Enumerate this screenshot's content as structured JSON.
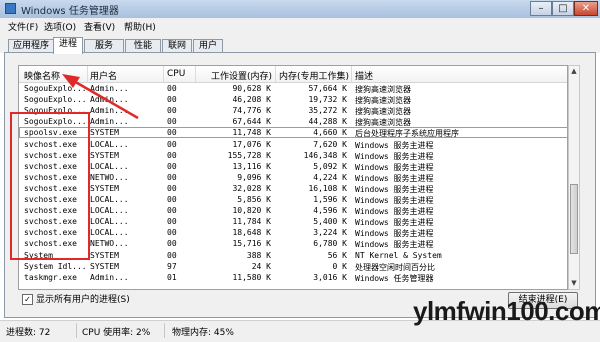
{
  "window": {
    "title": "Windows 任务管理器",
    "min": "–",
    "max": "□",
    "close": "✕"
  },
  "menu": [
    "文件(F)",
    "选项(O)",
    "查看(V)",
    "帮助(H)"
  ],
  "tabs": [
    "应用程序",
    "进程",
    "服务",
    "性能",
    "联网",
    "用户"
  ],
  "active_tab": "进程",
  "columns": [
    "映像名称",
    "用户名",
    "CPU",
    "工作设置(内存)",
    "内存(专用工作集)",
    "描述"
  ],
  "rows": [
    [
      "SogouExplo...",
      "Admin...",
      "00",
      "90,628 K",
      "57,664 K",
      "搜狗高速浏览器"
    ],
    [
      "SogouExplo...",
      "Admin...",
      "00",
      "46,208 K",
      "19,732 K",
      "搜狗高速浏览器"
    ],
    [
      "SogouExplo...",
      "Admin...",
      "00",
      "74,776 K",
      "35,272 K",
      "搜狗高速浏览器"
    ],
    [
      "SogouExplo...",
      "Admin...",
      "00",
      "67,644 K",
      "44,288 K",
      "搜狗高速浏览器"
    ],
    [
      "spoolsv.exe",
      "SYSTEM",
      "00",
      "11,748 K",
      "4,660 K",
      "后台处理程序子系统应用程序"
    ],
    [
      "svchost.exe",
      "LOCAL...",
      "00",
      "17,076 K",
      "7,620 K",
      "Windows 服务主进程"
    ],
    [
      "svchost.exe",
      "SYSTEM",
      "00",
      "155,728 K",
      "146,348 K",
      "Windows 服务主进程"
    ],
    [
      "svchost.exe",
      "LOCAL...",
      "00",
      "13,116 K",
      "5,092 K",
      "Windows 服务主进程"
    ],
    [
      "svchost.exe",
      "NETWO...",
      "00",
      "9,096 K",
      "4,224 K",
      "Windows 服务主进程"
    ],
    [
      "svchost.exe",
      "SYSTEM",
      "00",
      "32,028 K",
      "16,108 K",
      "Windows 服务主进程"
    ],
    [
      "svchost.exe",
      "LOCAL...",
      "00",
      "5,856 K",
      "1,596 K",
      "Windows 服务主进程"
    ],
    [
      "svchost.exe",
      "LOCAL...",
      "00",
      "10,820 K",
      "4,596 K",
      "Windows 服务主进程"
    ],
    [
      "svchost.exe",
      "LOCAL...",
      "00",
      "11,784 K",
      "5,400 K",
      "Windows 服务主进程"
    ],
    [
      "svchost.exe",
      "LOCAL...",
      "00",
      "18,648 K",
      "3,224 K",
      "Windows 服务主进程"
    ],
    [
      "svchost.exe",
      "NETWO...",
      "00",
      "15,716 K",
      "6,780 K",
      "Windows 服务主进程"
    ],
    [
      "System",
      "SYSTEM",
      "00",
      "388 K",
      "56 K",
      "NT Kernel & System"
    ],
    [
      "System Idl...",
      "SYSTEM",
      "97",
      "24 K",
      "0 K",
      "处理器空闲时间百分比"
    ],
    [
      "taskmgr.exe",
      "Admin...",
      "01",
      "11,580 K",
      "3,016 K",
      "Windows 任务管理器"
    ],
    [
      "",
      "",
      "",
      "",
      "",
      ""
    ]
  ],
  "selected_row": 4,
  "show_all": {
    "label": "显示所有用户的进程(S)",
    "checked": "✓"
  },
  "end_process": "结束进程(E)",
  "status": {
    "processes": "进程数: 72",
    "cpu": "CPU 使用率: 2%",
    "memory": "物理内存: 45%"
  },
  "watermark": "ylmfwin100.com",
  "highlight_color": "#e02a2a"
}
